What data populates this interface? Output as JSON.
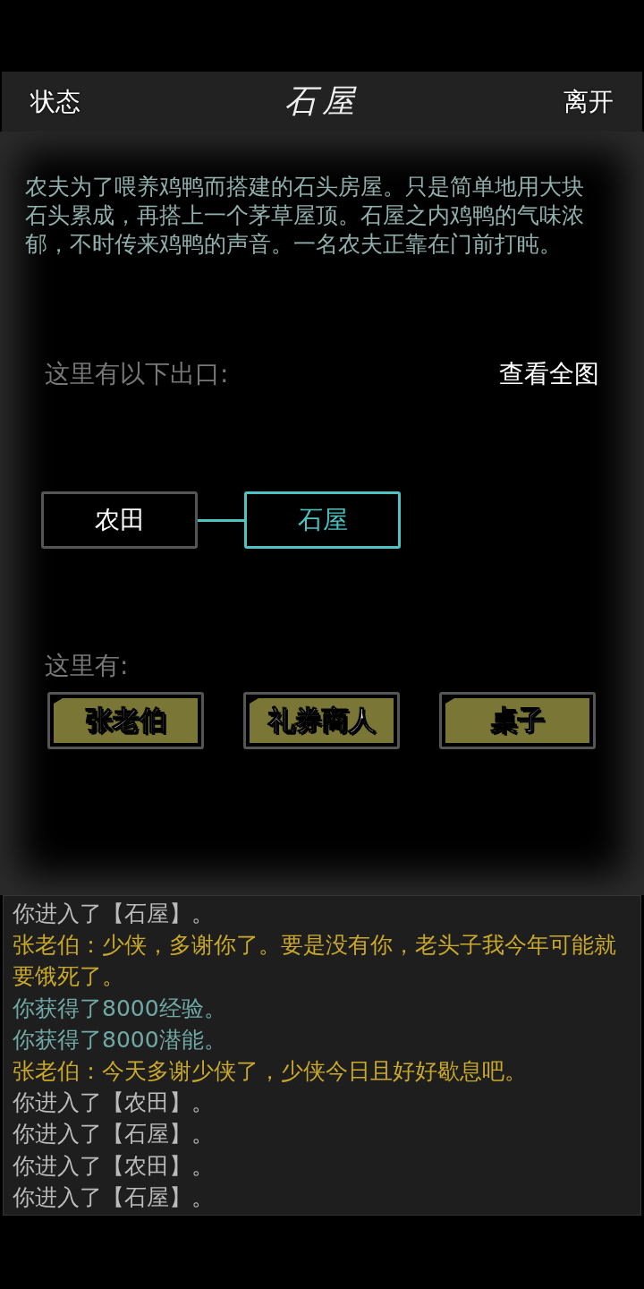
{
  "header": {
    "left_button": "状态",
    "title": "石屋",
    "right_button": "离开"
  },
  "description": "农夫为了喂养鸡鸭而搭建的石头房屋。只是简单地用大块石头累成，再搭上一个茅草屋顶。石屋之内鸡鸭的气味浓郁，不时传来鸡鸭的声音。一名农夫正靠在门前打盹。",
  "exits": {
    "label": "这里有以下出口:",
    "map_button": "查看全图",
    "rooms": [
      {
        "name": "农田",
        "selected": false
      },
      {
        "name": "石屋",
        "selected": true
      }
    ]
  },
  "present": {
    "label": "这里有:",
    "items": [
      "张老伯",
      "礼券商人",
      "桌子"
    ]
  },
  "log": [
    {
      "kind": "system",
      "text": "你进入了【石屋】。"
    },
    {
      "kind": "npc",
      "text": "张老伯：少侠，多谢你了。要是没有你，老头子我今年可能就要饿死了。"
    },
    {
      "kind": "reward",
      "text": "你获得了8000经验。"
    },
    {
      "kind": "reward",
      "text": "你获得了8000潜能。"
    },
    {
      "kind": "npc",
      "text": "张老伯：今天多谢少侠了，少侠今日且好好歇息吧。"
    },
    {
      "kind": "system",
      "text": "你进入了【农田】。"
    },
    {
      "kind": "system",
      "text": "你进入了【石屋】。"
    },
    {
      "kind": "system",
      "text": "你进入了【农田】。"
    },
    {
      "kind": "system",
      "text": "你进入了【石屋】。"
    }
  ]
}
